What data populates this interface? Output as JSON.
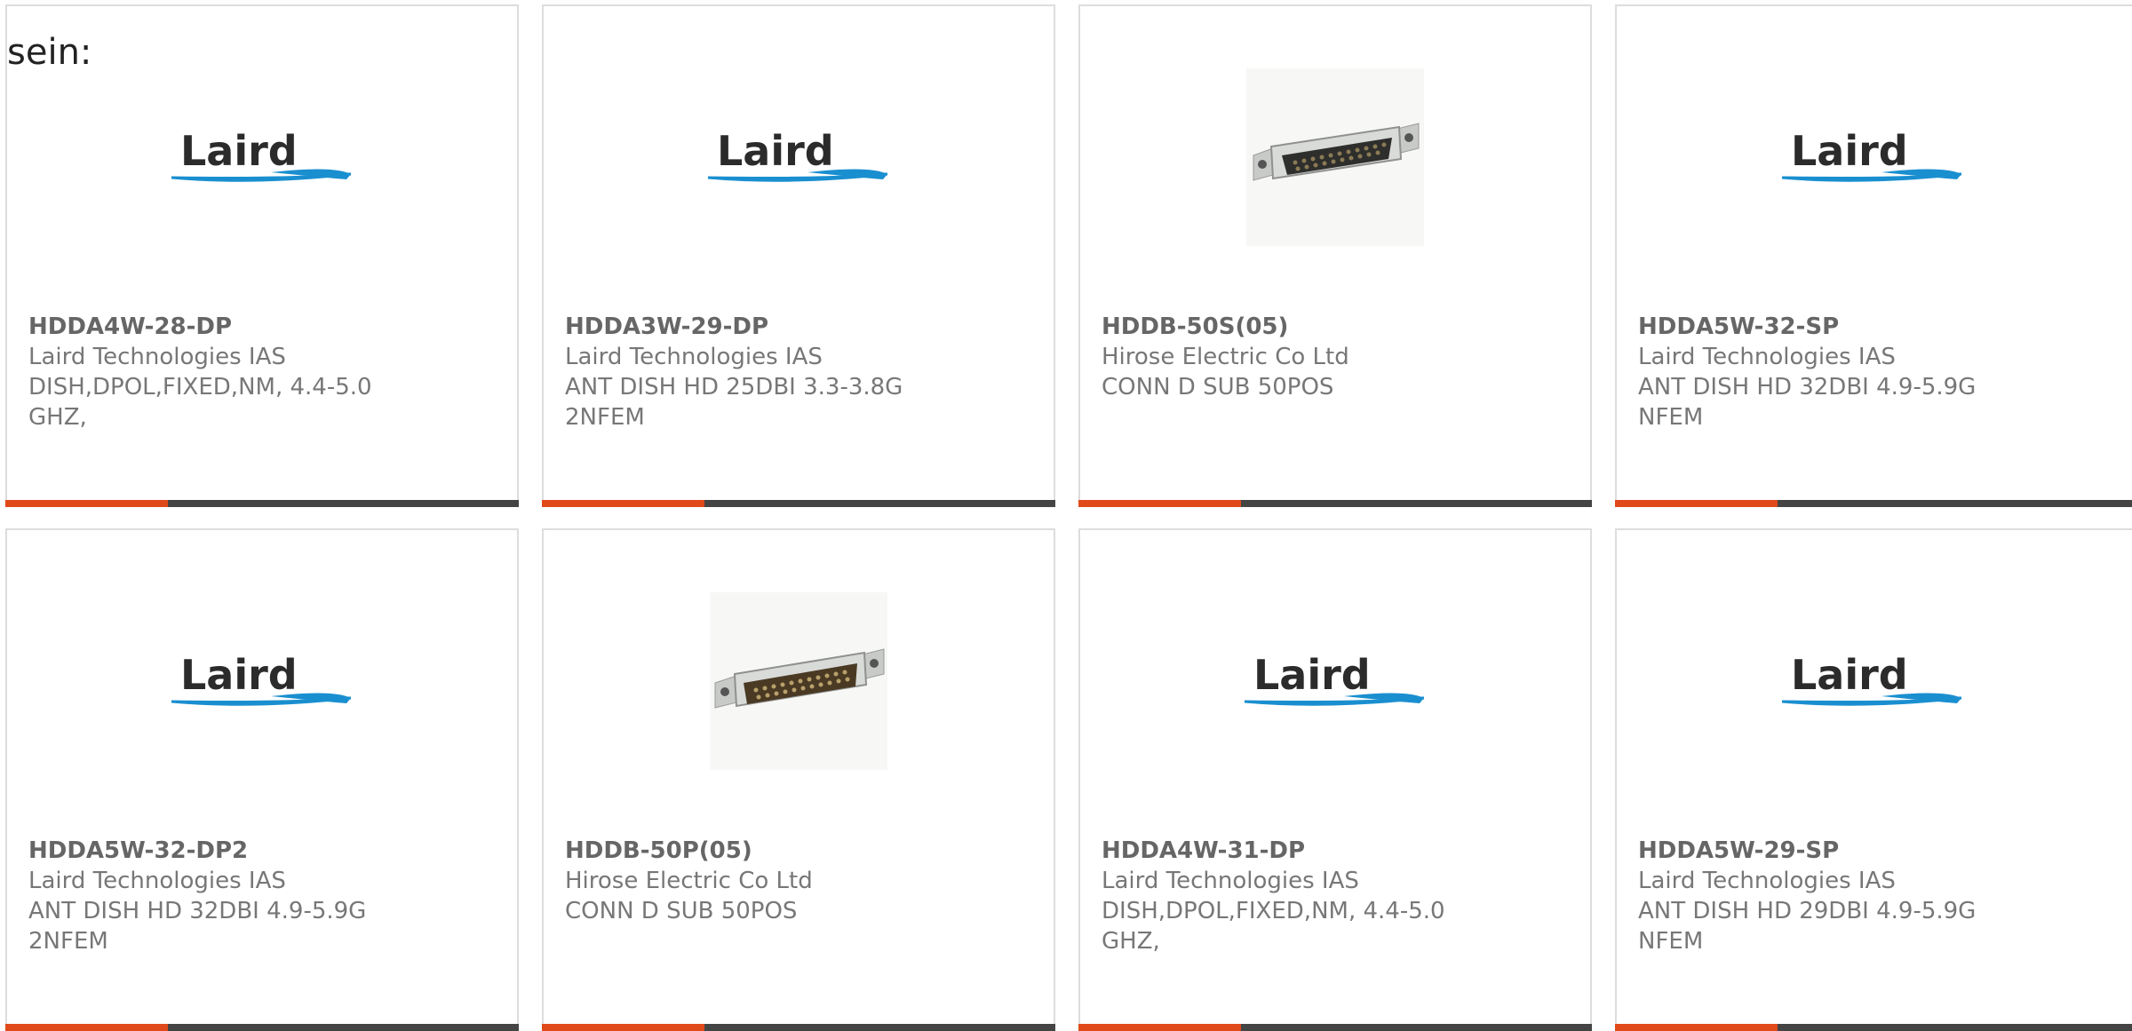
{
  "intro_text": "sein:",
  "products": [
    {
      "part": "HDDA4W-28-DP",
      "manufacturer": "Laird Technologies IAS",
      "description": "DISH,DPOL,FIXED,NM, 4.4-5.0 GHZ,",
      "image": "laird-logo"
    },
    {
      "part": "HDDA3W-29-DP",
      "manufacturer": "Laird Technologies IAS",
      "description": "ANT DISH HD 25DBI 3.3-3.8G 2NFEM",
      "image": "laird-logo"
    },
    {
      "part": "HDDB-50S(05)",
      "manufacturer": "Hirose Electric Co Ltd",
      "description": "CONN D SUB 50POS",
      "image": "dsub-connector-photo"
    },
    {
      "part": "HDDA5W-32-SP",
      "manufacturer": "Laird Technologies IAS",
      "description": "ANT DISH HD 32DBI 4.9-5.9G NFEM",
      "image": "laird-logo"
    },
    {
      "part": "HDDA5W-32-DP2",
      "manufacturer": "Laird Technologies IAS",
      "description": "ANT DISH HD 32DBI 4.9-5.9G 2NFEM",
      "image": "laird-logo"
    },
    {
      "part": "HDDB-50P(05)",
      "manufacturer": "Hirose Electric Co Ltd",
      "description": "CONN D SUB 50POS",
      "image": "dsub-connector-photo"
    },
    {
      "part": "HDDA4W-31-DP",
      "manufacturer": "Laird Technologies IAS",
      "description": "DISH,DPOL,FIXED,NM, 4.4-5.0 GHZ,",
      "image": "laird-logo"
    },
    {
      "part": "HDDA5W-29-SP",
      "manufacturer": "Laird Technologies IAS",
      "description": "ANT DISH HD 29DBI 4.9-5.9G NFEM",
      "image": "laird-logo"
    }
  ],
  "logo_text": "Laird",
  "colors": {
    "accent": "#e04a1a",
    "bar": "#444444",
    "laird_blue": "#1a8fd0",
    "text": "#777777"
  }
}
